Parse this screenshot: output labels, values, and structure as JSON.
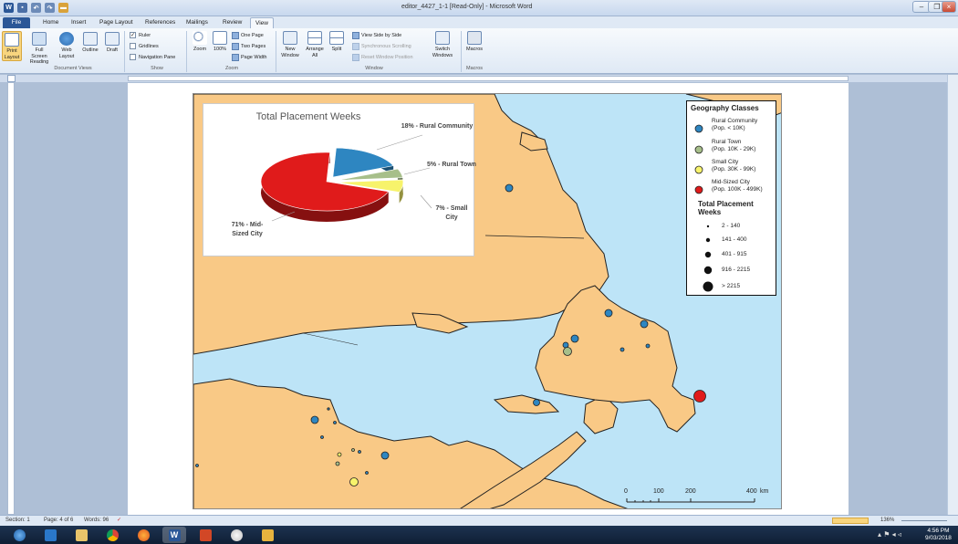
{
  "window": {
    "title": "editor_4427_1-1 [Read-Only] - Microsoft Word"
  },
  "tabs": [
    "File",
    "Home",
    "Insert",
    "Page Layout",
    "References",
    "Mailings",
    "Review",
    "View"
  ],
  "ribbon": {
    "document_views": {
      "label": "Document Views",
      "buttons": [
        "Print Layout",
        "Full Screen Reading",
        "Web Layout",
        "Outline",
        "Draft"
      ]
    },
    "show": {
      "label": "Show",
      "checkboxes": [
        {
          "label": "Ruler",
          "checked": true
        },
        {
          "label": "Gridlines",
          "checked": false
        },
        {
          "label": "Navigation Pane",
          "checked": false
        }
      ]
    },
    "zoom": {
      "label": "Zoom",
      "buttons": [
        "Zoom",
        "100%"
      ],
      "small": [
        "One Page",
        "Two Pages",
        "Page Width"
      ]
    },
    "window": {
      "label": "Window",
      "buttons": [
        "New Window",
        "Arrange All",
        "Split"
      ],
      "small": [
        "View Side by Side",
        "Synchronous Scrolling",
        "Reset Window Position"
      ],
      "switch": "Switch Windows"
    },
    "macros": {
      "label": "Macros",
      "button": "Macros"
    }
  },
  "chart_data": {
    "type": "pie",
    "title": "Total Placement Weeks",
    "slices": [
      {
        "label": "Rural Community",
        "percent": 18,
        "text": "18% - Rural Community",
        "color": "#2e86c1"
      },
      {
        "label": "Rural Town",
        "percent": 5,
        "text": "5% - Rural Town",
        "color": "#a7bf8a"
      },
      {
        "label": "Small City",
        "percent": 7,
        "text": "7% - Small City",
        "color": "#f7f36b"
      },
      {
        "label": "Mid-Sized City",
        "percent": 71,
        "text": "71% - Mid-Sized City",
        "color": "#e01b1b"
      }
    ]
  },
  "legend": {
    "title": "Geography Classes",
    "classes": [
      {
        "name": "Rural Community",
        "pop": "(Pop. < 10K)",
        "color": "#2e86c1"
      },
      {
        "name": "Rural Town",
        "pop": "(Pop. 10K - 29K)",
        "color": "#a7bf8a"
      },
      {
        "name": "Small City",
        "pop": "(Pop. 30K - 99K)",
        "color": "#f7f36b"
      },
      {
        "name": "Mid-Sized City",
        "pop": "(Pop. 100K - 499K)",
        "color": "#e01b1b"
      }
    ],
    "size_title": "Total Placement Weeks",
    "sizes": [
      "2 - 140",
      "141 - 400",
      "401 - 915",
      "916 - 2215",
      "> 2215"
    ]
  },
  "scale": {
    "ticks": [
      "0",
      "100",
      "200",
      "400"
    ],
    "unit": "km"
  },
  "statusbar": {
    "section": "Section: 1",
    "page": "Page: 4 of 6",
    "words": "Words: 96",
    "zoom": "136%"
  },
  "taskbar": {
    "time": "4:56 PM",
    "date": "9/03/2018"
  }
}
